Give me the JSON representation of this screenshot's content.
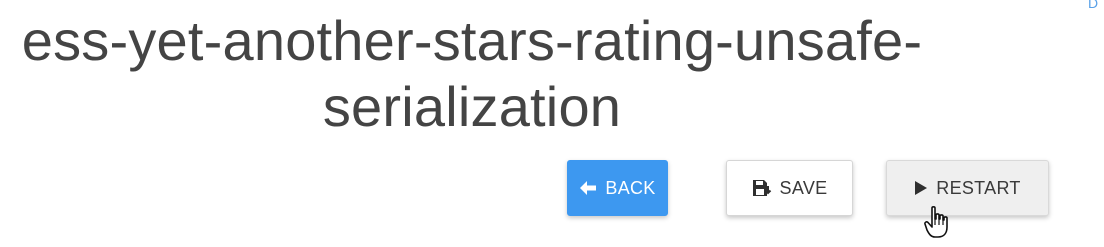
{
  "header": {
    "title_line1": "ess-yet-another-stars-rating-unsafe-",
    "title_line2": "serialization",
    "corner_mark": "D"
  },
  "toolbar": {
    "back_label": "BACK",
    "save_label": "SAVE",
    "restart_label": "RESTART"
  },
  "icons": {
    "back": "arrow-left-icon",
    "save": "save-icon",
    "restart": "play-icon",
    "cursor": "hand-pointer-icon"
  },
  "colors": {
    "back_button": "#3d98f0",
    "title_text": "#444444",
    "restart_button": "#efefef",
    "save_button": "#ffffff"
  }
}
